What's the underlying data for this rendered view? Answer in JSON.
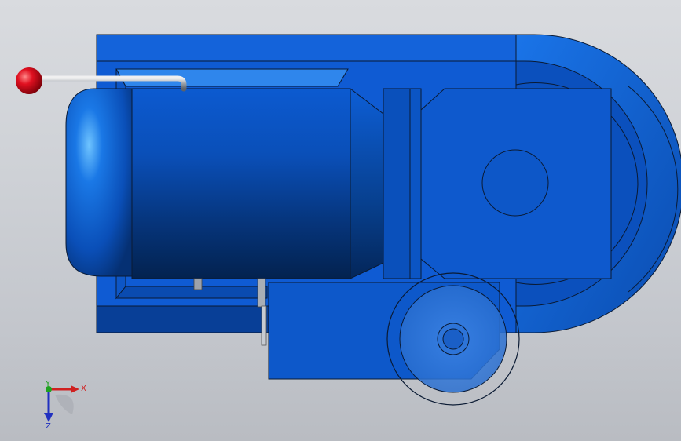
{
  "viewport": {
    "background_top": "#d9dbdf",
    "background_bottom": "#b9bcc2"
  },
  "model": {
    "part_color": "#1060d8",
    "part_dark": "#063f8f",
    "edge_color": "#0a1a33",
    "handle_knob_color": "#d0101a"
  },
  "triad": {
    "x_label": "X",
    "y_label": "Y",
    "z_label": "Z",
    "x_color": "#d02020",
    "y_color": "#1fa21f",
    "z_color": "#2030c0"
  }
}
